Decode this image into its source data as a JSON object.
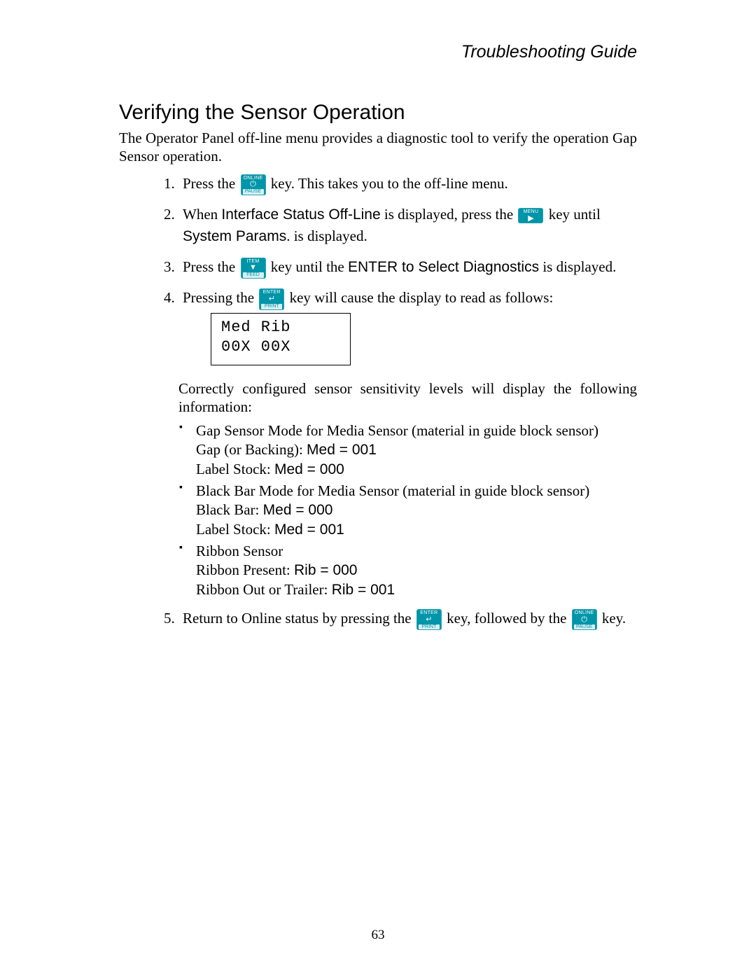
{
  "header": "Troubleshooting Guide",
  "title": "Verifying the Sensor Operation",
  "intro": "The Operator Panel off-line menu provides a diagnostic tool to verify the operation Gap Sensor operation.",
  "keys": {
    "online_pause": {
      "top": "ONLINE",
      "mid": "⏻",
      "bot": "PAUSE"
    },
    "menu": {
      "top": "MENU",
      "mid": "▶",
      "bot": ""
    },
    "item_feed": {
      "top": "ITEM",
      "mid": "▼",
      "bot": "FEED"
    },
    "enter_print": {
      "top": "ENTER",
      "mid": "↵",
      "bot": "PRINT"
    }
  },
  "steps": {
    "s1a": "Press the ",
    "s1b": " key. This takes you to the off-line menu.",
    "s2a": "When ",
    "s2b": "Interface Status Off-Line",
    "s2c": " is displayed, press the ",
    "s2d": " key until ",
    "s2e": "System Params",
    "s2f": ". is displayed.",
    "s3a": "Press the ",
    "s3b": " key until the ",
    "s3c": "ENTER to Select Diagnostics",
    "s3d": " is displayed.",
    "s4a": "Pressing the ",
    "s4b": " key will cause the display to read as follows:",
    "s5a": "Return to Online status by pressing the ",
    "s5b": " key, followed by the ",
    "s5c": " key."
  },
  "display": {
    "line1": "Med Rib",
    "line2": "00X 00X"
  },
  "para2": "Correctly configured sensor sensitivity levels will display the following information:",
  "bullets": {
    "b1l1": "Gap Sensor Mode for Media Sensor (material in guide block sensor)",
    "b1l2a": "Gap (or Backing): ",
    "b1l2b": "Med = 001",
    "b1l3a": "Label Stock: ",
    "b1l3b": "Med = 000",
    "b2l1": "Black Bar Mode for Media Sensor (material in guide block sensor)",
    "b2l2a": "Black Bar: ",
    "b2l2b": "Med = 000",
    "b2l3a": "Label Stock: ",
    "b2l3b": "Med = 001",
    "b3l1": "Ribbon Sensor",
    "b3l2a": "Ribbon Present: ",
    "b3l2b": "Rib = 000",
    "b3l3a": "Ribbon Out or Trailer: ",
    "b3l3b": "Rib = 001"
  },
  "page_number": "63"
}
